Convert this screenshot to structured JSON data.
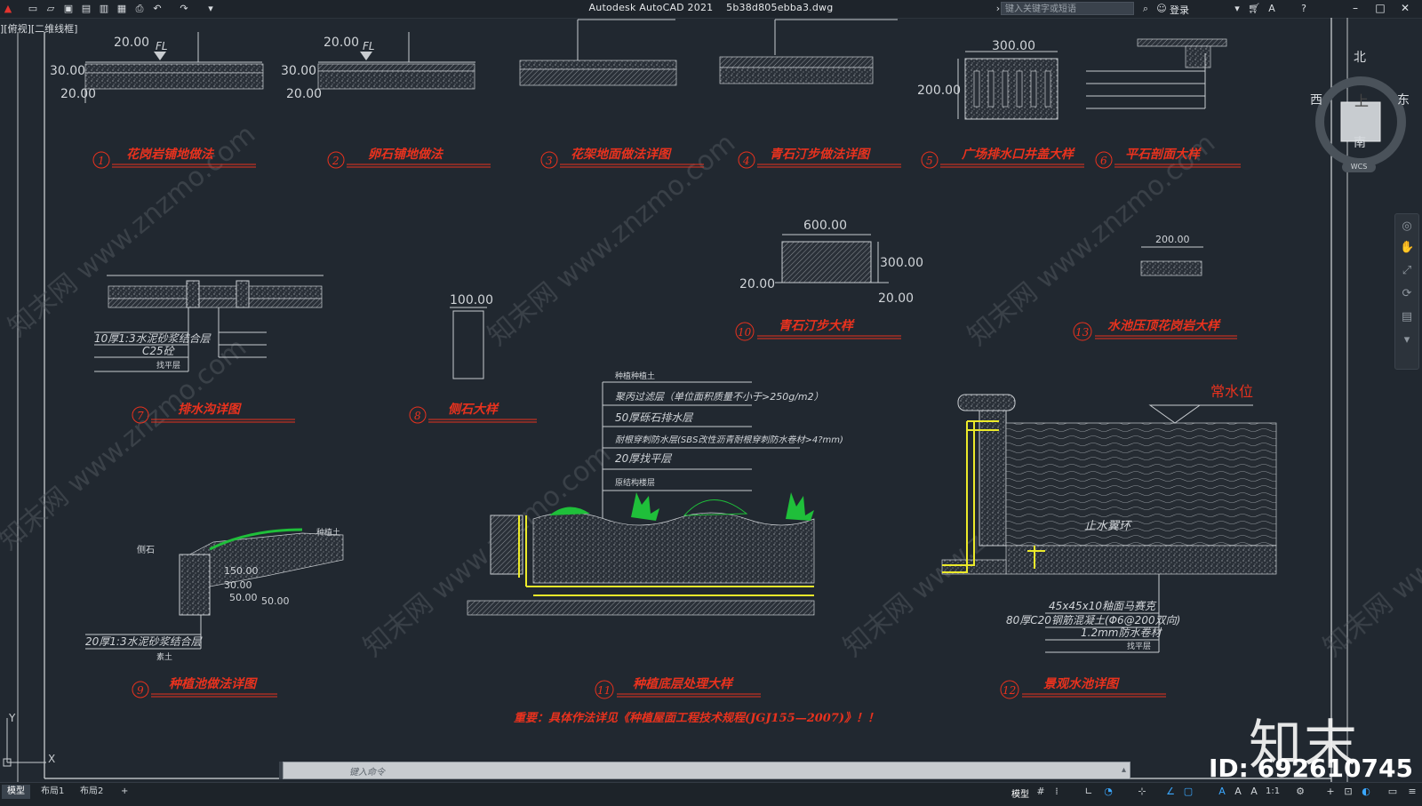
{
  "app": {
    "title": "Autodesk AutoCAD 2021",
    "filename": "5b38d805ebba3.dwg",
    "search_placeholder": "键入关键字或短语",
    "login_label": "登录",
    "view_label": "][俯视][二维线框]"
  },
  "viewcube": {
    "north": "北",
    "south": "南",
    "east": "东",
    "west": "西",
    "top": "上",
    "wcs": "WCS"
  },
  "command": {
    "placeholder": "键入命令"
  },
  "status": {
    "tabs": [
      "模型",
      "布局1",
      "布局2"
    ],
    "add_tab": "+",
    "model_label": "模型",
    "scale_label": "1:1"
  },
  "brand": {
    "logo": "知末",
    "id_text": "ID: 692610745"
  },
  "drawing": {
    "watermark": "知末网 www.znzmo.com",
    "details": [
      {
        "num": "1",
        "title": "花岗岩铺地做法"
      },
      {
        "num": "2",
        "title": "卵石铺地做法"
      },
      {
        "num": "3",
        "title": "花架地面做法详图"
      },
      {
        "num": "4",
        "title": "青石汀步做法详图"
      },
      {
        "num": "5",
        "title": "广场排水口井盖大样"
      },
      {
        "num": "6",
        "title": "平石剖面大样"
      },
      {
        "num": "7",
        "title": "排水沟详图"
      },
      {
        "num": "8",
        "title": "侧石大样"
      },
      {
        "num": "9",
        "title": "种植池做法详图"
      },
      {
        "num": "10",
        "title": "青石汀步大样"
      },
      {
        "num": "11",
        "title": "种植底层处理大样"
      },
      {
        "num": "12",
        "title": "景观水池详图"
      },
      {
        "num": "13",
        "title": "水池压顶花岗岩大样"
      }
    ],
    "note": "重要：具体作法详见《种植屋面工程技术规程(JGJ155—2007)》！！",
    "water_level": "常水位",
    "stop_ring": "止水翼环",
    "dims": {
      "d1a": "20.00",
      "d1b": "30.00",
      "d1c": "20.00",
      "fl": "FL",
      "d2a": "20.00",
      "d2b": "30.00",
      "d2c": "20.00",
      "d5a": "300.00",
      "d5b": "200.00",
      "d10a": "600.00",
      "d10b": "300.00",
      "d10c": "20.00",
      "d10d": "20.00",
      "d8a": "100.00",
      "d13a": "200.00",
      "d9a": "150.00",
      "d9b": "30.00",
      "d9c": "50.00",
      "d9d": "50.00"
    },
    "layers11": [
      "种植种植土",
      "聚丙过滤层（单位面积质量不小于>250g/m2）",
      "50厚砾石排水层",
      "耐根穿刺防水层(SBS改性沥青耐根穿刺防水卷材>4?mm)",
      "20厚找平层",
      "原结构楼层"
    ],
    "layers7": [
      "10厚1:3水泥砂浆结合层",
      "C25砼",
      "找平层"
    ],
    "layers12": [
      "45x45x10釉面马赛克",
      "80厚C20钢筋混凝土(Φ6@200双向)",
      "1.2mm防水卷材",
      "找平层"
    ],
    "layers9": [
      "20厚1:3水泥砂浆结合层",
      "素土"
    ],
    "stone_label": "侧石",
    "planting_label": "种植土"
  }
}
